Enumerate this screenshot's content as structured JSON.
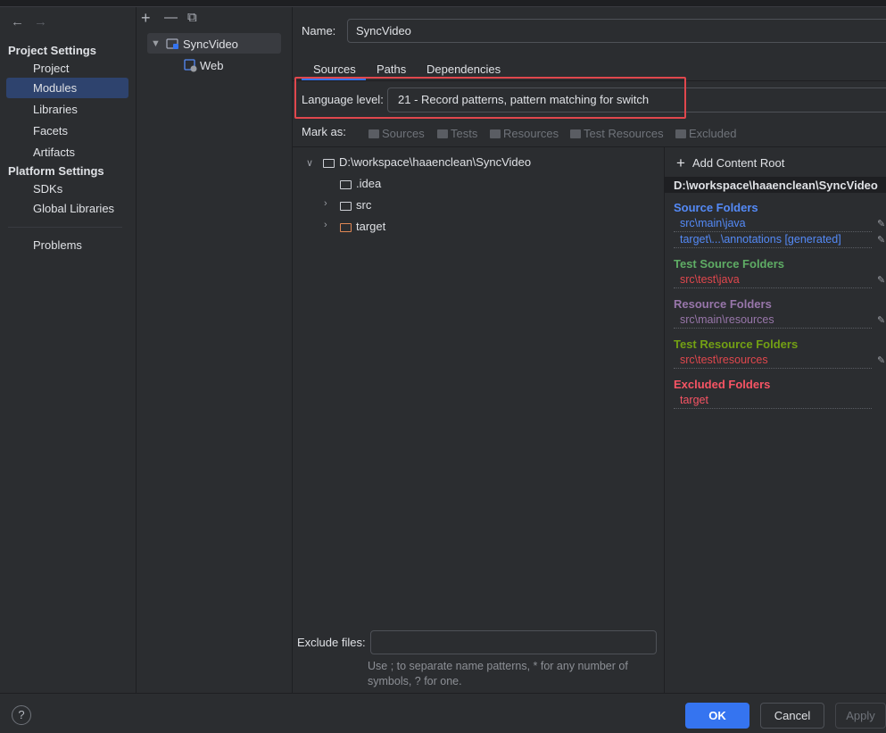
{
  "nav": {
    "back_icon": "←",
    "forward_icon": "→",
    "project_settings_header": "Project Settings",
    "platform_settings_header": "Platform Settings",
    "items": [
      "Project",
      "Modules",
      "Libraries",
      "Facets",
      "Artifacts"
    ],
    "platform_items": [
      "SDKs",
      "Global Libraries"
    ],
    "problems": "Problems"
  },
  "modules": {
    "add_icon": "+",
    "remove_icon": "—",
    "copy_icon": "⧉",
    "root": "SyncVideo",
    "child": "Web"
  },
  "content": {
    "name_label": "Name:",
    "name_value": "SyncVideo",
    "tabs": [
      "Sources",
      "Paths",
      "Dependencies"
    ],
    "language_level_label": "Language level:",
    "language_level_value": "21 - Record patterns, pattern matching for switch",
    "mark_as_label": "Mark as:",
    "mark_as": [
      "Sources",
      "Tests",
      "Resources",
      "Test Resources",
      "Excluded"
    ],
    "tree": {
      "root": "D:\\workspace\\haaenclean\\SyncVideo",
      "children": [
        ".idea",
        "src",
        "target"
      ]
    },
    "exclude_files_label": "Exclude files:",
    "exclude_files_value": "",
    "hint_line1": "Use ; to separate name patterns, * for any number of",
    "hint_line2": "symbols, ? for one."
  },
  "roots": {
    "add_content_root": "Add Content Root",
    "path": "D:\\workspace\\haaenclean\\SyncVideo",
    "source_folders_title": "Source Folders",
    "source_folders": [
      "src\\main\\java",
      "target\\...\\annotations [generated]"
    ],
    "test_source_title": "Test Source Folders",
    "test_source_folders": [
      "src\\test\\java"
    ],
    "resource_title": "Resource Folders",
    "resource_folders": [
      "src\\main\\resources"
    ],
    "test_resource_title": "Test Resource Folders",
    "test_resource_folders": [
      "src\\test\\resources"
    ],
    "excluded_title": "Excluded Folders",
    "excluded_folders": [
      "target"
    ]
  },
  "colors": {
    "source": "#548af7",
    "test_source": "#5fad65",
    "resource": "#9876aa",
    "test_resource": "#73a014",
    "excluded": "#f75464",
    "test_item": "#e0474d"
  },
  "buttons": {
    "help": "?",
    "ok": "OK",
    "cancel": "Cancel",
    "apply": "Apply"
  }
}
